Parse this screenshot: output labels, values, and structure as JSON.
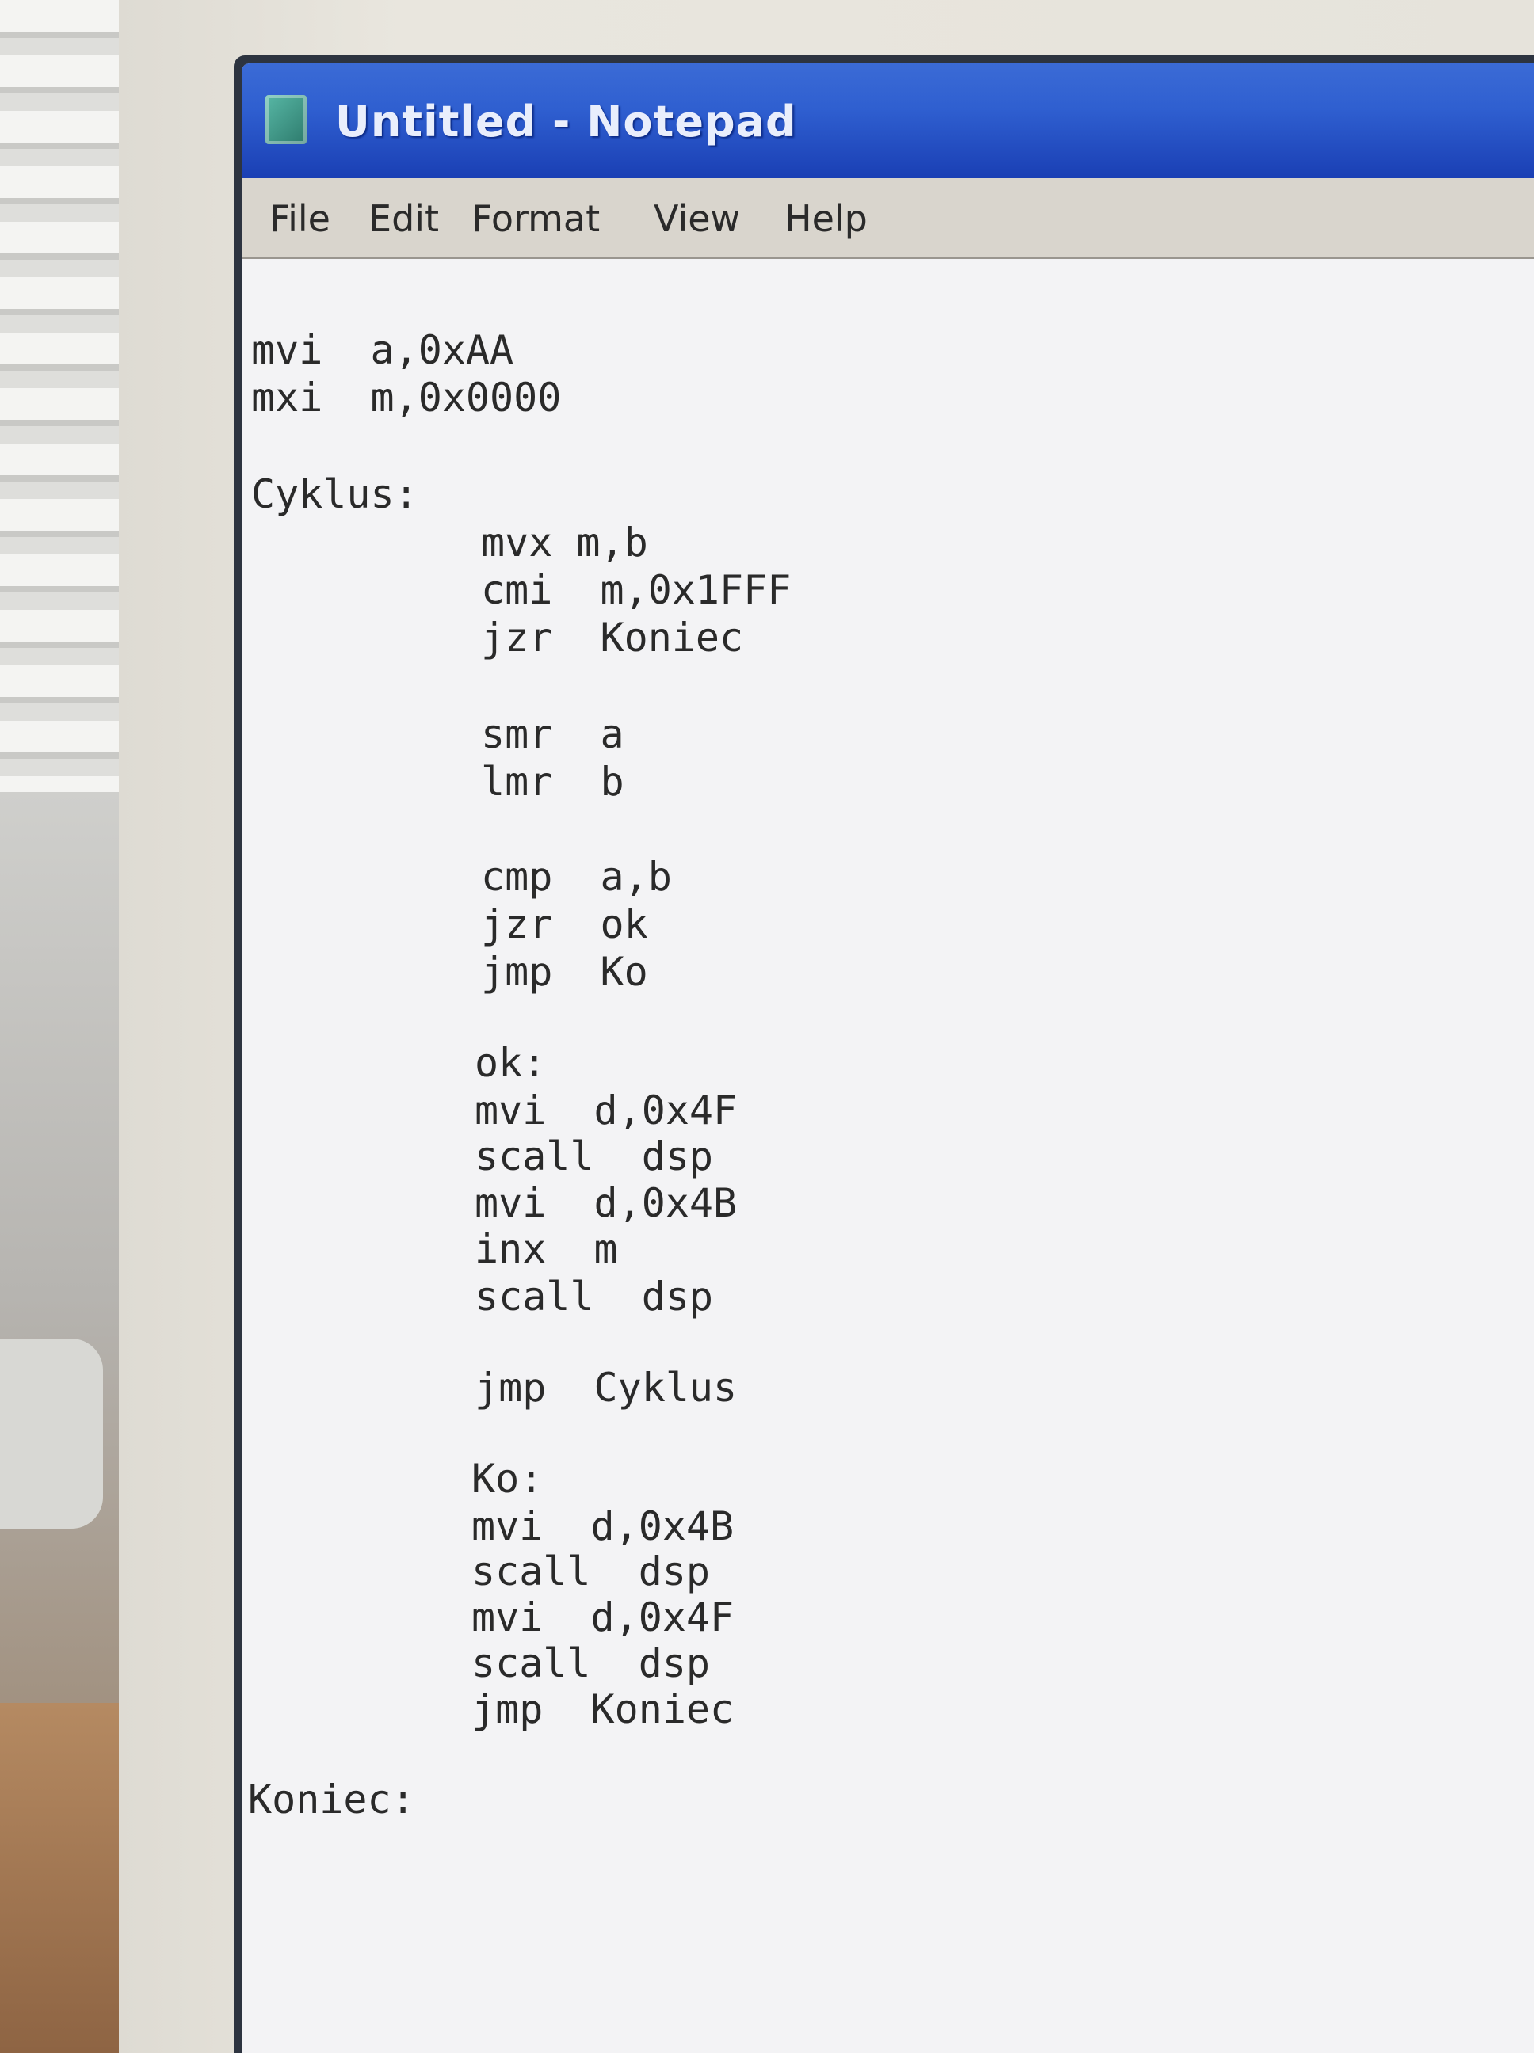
{
  "window": {
    "title": "Untitled - Notepad",
    "app_icon": "notepad-icon"
  },
  "menu": [
    "File",
    "Edit",
    "Format",
    "View",
    "Help"
  ],
  "editor": {
    "lines": [
      "mvi  a,0xAA",
      "mxi  m,0x0000",
      "Cyklus:",
      "mvx m,b",
      "cmi  m,0x1FFF",
      "jzr  Koniec",
      "smr  a",
      "lmr  b",
      "cmp  a,b",
      "jzr  ok",
      "jmp  Ko",
      "ok:",
      "mvi  d,0x4F",
      "scall  dsp",
      "mvi  d,0x4B",
      "inx  m",
      "scall  dsp",
      "jmp  Cyklus",
      "Ko:",
      "mvi  d,0x4B",
      "scall  dsp",
      "mvi  d,0x4F",
      "scall  dsp",
      "jmp  Koniec",
      "Koniec:"
    ]
  }
}
